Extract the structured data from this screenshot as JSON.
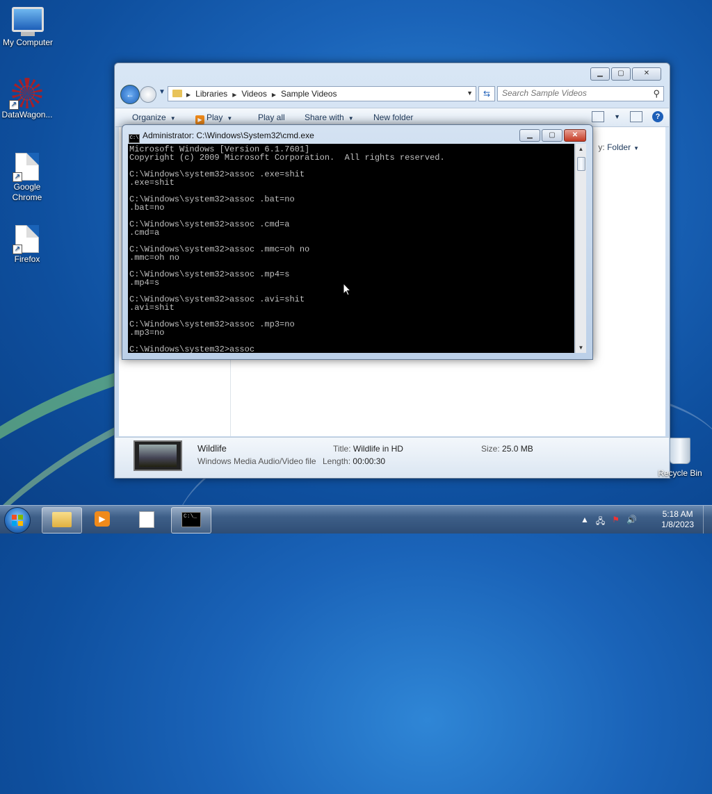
{
  "desktop": {
    "icons": [
      {
        "label": "My Computer"
      },
      {
        "label": "DataWagon..."
      },
      {
        "label": "Google\nChrome"
      },
      {
        "label": "Firefox"
      }
    ],
    "recycle_bin": "Recycle Bin"
  },
  "explorer": {
    "breadcrumbs": [
      "Libraries",
      "Videos",
      "Sample Videos"
    ],
    "search_placeholder": "Search Sample Videos",
    "toolbar": {
      "organize": "Organize",
      "play": "Play",
      "play_all": "Play all",
      "share_with": "Share with",
      "new_folder": "New folder"
    },
    "arrange_prefix": "y:",
    "arrange_value": "Folder",
    "details": {
      "name": "Wildlife",
      "type": "Windows Media Audio/Video file",
      "title_label": "Title:",
      "title_value": "Wildlife in HD",
      "length_label": "Length:",
      "length_value": "00:00:30",
      "size_label": "Size:",
      "size_value": "25.0 MB"
    }
  },
  "cmd": {
    "title": "Administrator: C:\\Windows\\System32\\cmd.exe",
    "icon_text": "C:\\",
    "output": "Microsoft Windows [Version 6.1.7601]\nCopyright (c) 2009 Microsoft Corporation.  All rights reserved.\n\nC:\\Windows\\system32>assoc .exe=shit\n.exe=shit\n\nC:\\Windows\\system32>assoc .bat=no\n.bat=no\n\nC:\\Windows\\system32>assoc .cmd=a\n.cmd=a\n\nC:\\Windows\\system32>assoc .mmc=oh no\n.mmc=oh no\n\nC:\\Windows\\system32>assoc .mp4=s\n.mp4=s\n\nC:\\Windows\\system32>assoc .avi=shit\n.avi=shit\n\nC:\\Windows\\system32>assoc .mp3=no\n.mp3=no\n\nC:\\Windows\\system32>assoc"
  },
  "taskbar": {
    "clock_time": "5:18 AM",
    "clock_date": "1/8/2023",
    "cmd_task_text": "C:\\_"
  }
}
